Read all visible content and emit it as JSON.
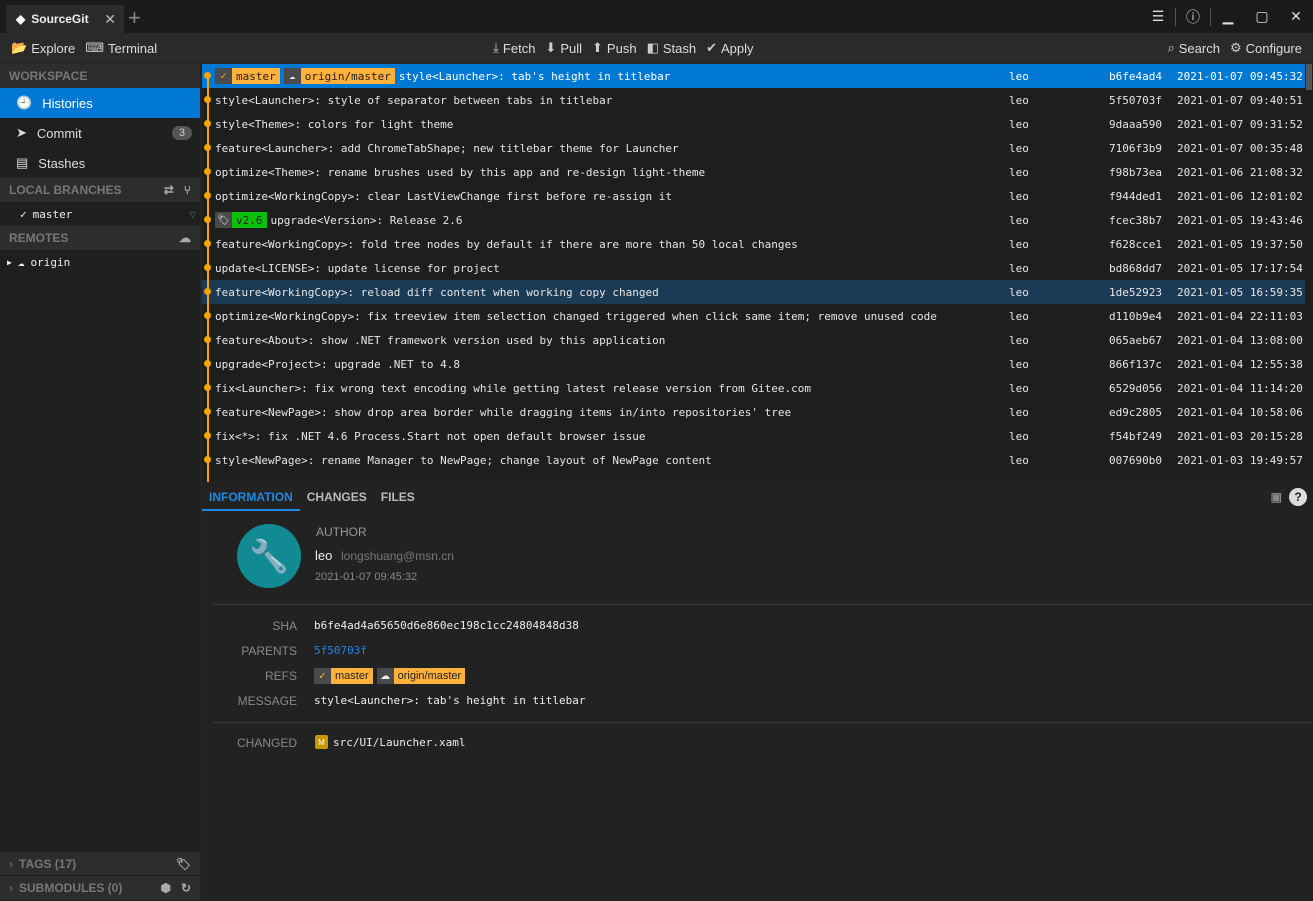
{
  "titlebar": {
    "tab_title": "SourceGit",
    "close": "✕",
    "add": "+",
    "icons": [
      "preferences-icon",
      "info-icon",
      "minimize-icon",
      "maximize-icon",
      "close-icon"
    ]
  },
  "toolbar": {
    "explore": "Explore",
    "terminal": "Terminal",
    "fetch": "Fetch",
    "pull": "Pull",
    "push": "Push",
    "stash": "Stash",
    "apply": "Apply",
    "search": "Search",
    "configure": "Configure"
  },
  "sidebar": {
    "workspace_header": "WORKSPACE",
    "items": [
      {
        "label": "Histories",
        "active": true
      },
      {
        "label": "Commit",
        "badge": "3"
      },
      {
        "label": "Stashes"
      }
    ],
    "local_branches_header": "LOCAL BRANCHES",
    "branches": [
      {
        "name": "master",
        "current": true
      }
    ],
    "remotes_header": "REMOTES",
    "remotes": [
      {
        "name": "origin"
      }
    ],
    "tags_header": "TAGS (17)",
    "submodules_header": "SUBMODULES (0)"
  },
  "colors": {
    "accent": "#0078d4",
    "branch_ref": "#ffb13b",
    "tag_ref": "#0bc10b",
    "graph": "#f5a500"
  },
  "commits": [
    {
      "refs": [
        {
          "type": "branch",
          "name": "master"
        },
        {
          "type": "remote",
          "name": "origin/master"
        }
      ],
      "message": "style<Launcher>: tab's height in titlebar",
      "author": "leo",
      "sha": "b6fe4ad4",
      "time": "2021-01-07 09:45:32",
      "selected": true
    },
    {
      "message": "style<Launcher>: style of separator between tabs in titlebar",
      "author": "leo",
      "sha": "5f50703f",
      "time": "2021-01-07 09:40:51"
    },
    {
      "message": "style<Theme>: colors for light theme",
      "author": "leo",
      "sha": "9daaa590",
      "time": "2021-01-07 09:31:52"
    },
    {
      "message": "feature<Launcher>: add ChromeTabShape; new titlebar theme for Launcher",
      "author": "leo",
      "sha": "7106f3b9",
      "time": "2021-01-07 00:35:48"
    },
    {
      "message": "optimize<Theme>: rename brushes used by this app and re-design light-theme",
      "author": "leo",
      "sha": "f98b73ea",
      "time": "2021-01-06 21:08:32"
    },
    {
      "message": "optimize<WorkingCopy>: clear LastViewChange first before re-assign it",
      "author": "leo",
      "sha": "f944ded1",
      "time": "2021-01-06 12:01:02"
    },
    {
      "refs": [
        {
          "type": "tag",
          "name": "v2.6"
        }
      ],
      "message": "upgrade<Version>: Release 2.6",
      "author": "leo",
      "sha": "fcec38b7",
      "time": "2021-01-05 19:43:46"
    },
    {
      "message": "feature<WorkingCopy>: fold tree nodes by default if there are more than 50 local changes",
      "author": "leo",
      "sha": "f628cce1",
      "time": "2021-01-05 19:37:50"
    },
    {
      "message": "update<LICENSE>: update license for project",
      "author": "leo",
      "sha": "bd868dd7",
      "time": "2021-01-05 17:17:54"
    },
    {
      "message": "feature<WorkingCopy>: reload diff content when working copy changed",
      "author": "leo",
      "sha": "1de52923",
      "time": "2021-01-05 16:59:35",
      "hover": true
    },
    {
      "message": "optimize<WorkingCopy>: fix treeview item selection changed triggered when click same item; remove unused code",
      "author": "leo",
      "sha": "d110b9e4",
      "time": "2021-01-04 22:11:03"
    },
    {
      "message": "feature<About>: show .NET framework version used by this application",
      "author": "leo",
      "sha": "065aeb67",
      "time": "2021-01-04 13:08:00"
    },
    {
      "message": "upgrade<Project>: upgrade .NET to 4.8",
      "author": "leo",
      "sha": "866f137c",
      "time": "2021-01-04 12:55:38"
    },
    {
      "message": "fix<Launcher>: fix wrong text encoding while getting latest release version from Gitee.com",
      "author": "leo",
      "sha": "6529d056",
      "time": "2021-01-04 11:14:20"
    },
    {
      "message": "feature<NewPage>: show drop area border while dragging items in/into repositories' tree",
      "author": "leo",
      "sha": "ed9c2805",
      "time": "2021-01-04 10:58:06"
    },
    {
      "message": "fix<*>: fix .NET 4.6 Process.Start not open default browser issue",
      "author": "leo",
      "sha": "f54bf249",
      "time": "2021-01-03 20:15:28"
    },
    {
      "message": "style<NewPage>: rename Manager to NewPage; change layout of NewPage content",
      "author": "leo",
      "sha": "007690b0",
      "time": "2021-01-03 19:49:57"
    }
  ],
  "detail": {
    "tabs": [
      "INFORMATION",
      "CHANGES",
      "FILES"
    ],
    "author_label": "AUTHOR",
    "author": "leo",
    "email": "longshuang@msn.cn",
    "time": "2021-01-07 09:45:32",
    "sha_label": "SHA",
    "sha": "b6fe4ad4a65650d6e860ec198c1cc24804848d38",
    "parents_label": "PARENTS",
    "parent": "5f50703f",
    "refs_label": "REFS",
    "refs": [
      "master",
      "origin/master"
    ],
    "message_label": "MESSAGE",
    "message": "style<Launcher>: tab's height in titlebar",
    "changed_label": "CHANGED",
    "changed": [
      {
        "status": "M",
        "path": "src/UI/Launcher.xaml"
      }
    ]
  }
}
